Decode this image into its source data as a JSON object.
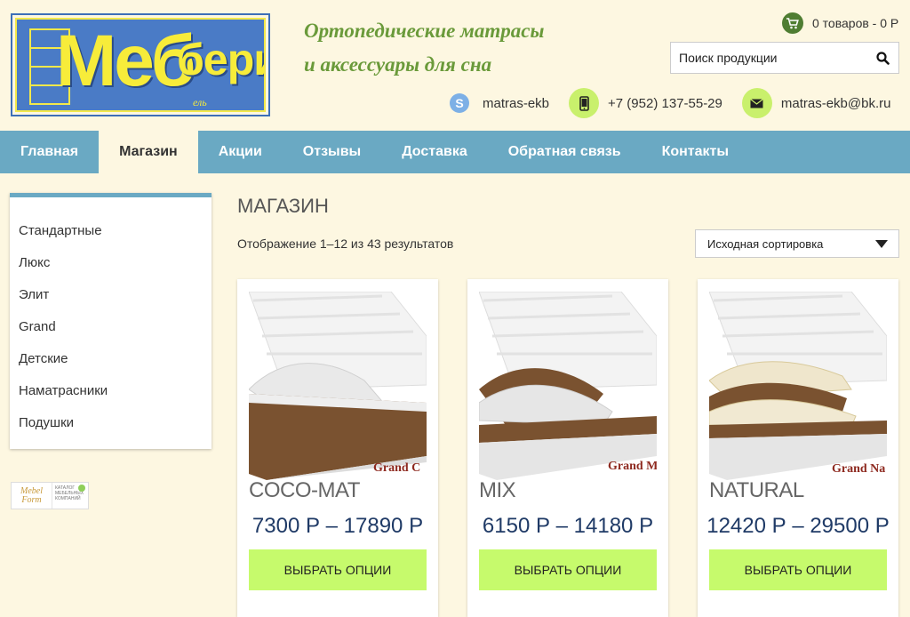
{
  "logo": {
    "main": "Меб",
    "sup": "бери",
    "small": "ель"
  },
  "tagline": {
    "line1": "Ортопедические матрасы",
    "line2": "и аксессуары для сна"
  },
  "cart": {
    "text": "0 товаров - 0 Р"
  },
  "search": {
    "placeholder": "Поиск продукции"
  },
  "contacts": {
    "skype": "matras-ekb",
    "phone": "+7 (952) 137-55-29",
    "email": "matras-ekb@bk.ru"
  },
  "nav": {
    "items": [
      {
        "label": "Главная"
      },
      {
        "label": "Магазин"
      },
      {
        "label": "Акции"
      },
      {
        "label": "Отзывы"
      },
      {
        "label": "Доставка"
      },
      {
        "label": "Обратная связь"
      },
      {
        "label": "Контакты"
      }
    ]
  },
  "sidebar": {
    "items": [
      {
        "label": "Стандартные"
      },
      {
        "label": "Люкс"
      },
      {
        "label": "Элит"
      },
      {
        "label": "Grand"
      },
      {
        "label": "Детские"
      },
      {
        "label": "Наматрасники"
      },
      {
        "label": "Подушки"
      }
    ]
  },
  "badge": {
    "line1": "Mebel",
    "line2": "Form",
    "text": "КАТАЛОГ МЕБЕЛЬНЫХ КОМПАНИЙ"
  },
  "main": {
    "title": "МАГАЗИН",
    "result_count": "Отображение 1–12 из 43 результатов",
    "sort": "Исходная сортировка"
  },
  "products": [
    {
      "name": "COCO-MAT",
      "price": "7300 Р – 17890 Р",
      "button": "ВЫБРАТЬ ОПЦИИ",
      "label": "Grand C"
    },
    {
      "name": "MIX",
      "price": "6150 Р – 14180 Р",
      "button": "ВЫБРАТЬ ОПЦИИ",
      "label": "Grand M"
    },
    {
      "name": "NATURAL",
      "price": "12420 Р – 29500 Р",
      "button": "ВЫБРАТЬ ОПЦИИ",
      "label": "Grand Na"
    }
  ],
  "colors": {
    "nav": "#6aa9c3",
    "button": "#c6fa6c",
    "background": "#fdf7e1",
    "tagline": "#6a9a3a",
    "price": "#1f3a66"
  }
}
